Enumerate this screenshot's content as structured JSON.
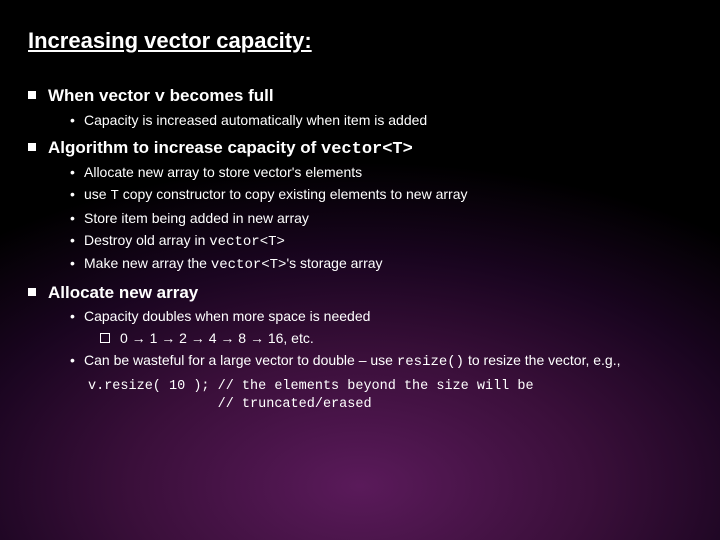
{
  "title": "Increasing vector capacity:",
  "s1": {
    "h_a": "When vector ",
    "h_code": "v",
    "h_b": " becomes full",
    "b1": "Capacity is increased automatically when item is added"
  },
  "s2": {
    "h_a": "Algorithm to increase capacity of ",
    "h_code": "vector<T>",
    "b1": "Allocate new array to store vector's elements",
    "b2_a": "use ",
    "b2_code": "T",
    "b2_b": " copy constructor to copy existing elements to new array",
    "b3": "Store item being added in new array",
    "b4_a": "Destroy old array in ",
    "b4_code": "vector<T>",
    "b5_a": "Make new array the ",
    "b5_code": "vector<T>",
    "b5_b": "'s storage array"
  },
  "s3": {
    "h": "Allocate new array",
    "b1": "Capacity doubles when more space is needed",
    "seq": "0 → 1 → 2 → 4 → 8 → 16, etc.",
    "b2_a": "Can be wasteful for a large vector to double – use ",
    "b2_code": "resize()",
    "b2_b": " to resize the vector, e.g.,",
    "code": "v.resize( 10 ); // the elements beyond the size will be\n                // truncated/erased"
  }
}
